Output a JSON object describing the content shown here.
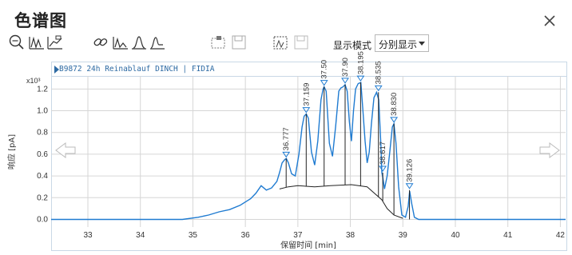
{
  "window": {
    "title": "色谱图"
  },
  "toolbar": {
    "mode_label": "显示模式",
    "mode_value": "分别显示"
  },
  "chart_data": {
    "type": "line",
    "header": "B9872 24h Reinablauf DINCH | FIDIA",
    "xlabel": "保留时间 [min]",
    "ylabel": "响应 [pA]",
    "y_multiplier": "x10³",
    "xlim": [
      32.3,
      42.1
    ],
    "ylim": [
      -0.07,
      1.32
    ],
    "xticks": [
      33,
      34,
      35,
      36,
      37,
      38,
      39,
      40,
      41,
      42
    ],
    "yticks": [
      0.0,
      0.2,
      0.4,
      0.6,
      0.8,
      1.0,
      1.2
    ],
    "grid": true,
    "peaks": [
      {
        "rt": 36.777,
        "label": "36.777",
        "height": 0.56
      },
      {
        "rt": 37.159,
        "label": "37.159",
        "height": 0.97
      },
      {
        "rt": 37.5,
        "label": "37.50",
        "height": 1.22
      },
      {
        "rt": 37.9,
        "label": "37.90",
        "height": 1.24
      },
      {
        "rt": 38.195,
        "label": "38.195",
        "height": 1.26
      },
      {
        "rt": 38.535,
        "label": "38.535",
        "height": 1.17
      },
      {
        "rt": 38.617,
        "label": "38.617",
        "height": 0.43
      },
      {
        "rt": 38.83,
        "label": "38.830",
        "height": 0.88
      },
      {
        "rt": 39.126,
        "label": "39.126",
        "height": 0.27
      }
    ],
    "series": [
      {
        "x": [
          32.3,
          34.8,
          35.1,
          35.3,
          35.5,
          35.7,
          35.9,
          36.0,
          36.1,
          36.2,
          36.3,
          36.4,
          36.5,
          36.6,
          36.65,
          36.7,
          36.75,
          36.78,
          36.82,
          36.88,
          36.95,
          37.02,
          37.08,
          37.12,
          37.16,
          37.2,
          37.26,
          37.32,
          37.38,
          37.44,
          37.48,
          37.5,
          37.54,
          37.6,
          37.66,
          37.72,
          37.78,
          37.82,
          37.86,
          37.9,
          37.94,
          37.98,
          38.02,
          38.06,
          38.1,
          38.15,
          38.2,
          38.24,
          38.28,
          38.32,
          38.36,
          38.4,
          38.45,
          38.5,
          38.54,
          38.58,
          38.6,
          38.62,
          38.65,
          38.7,
          38.75,
          38.8,
          38.83,
          38.87,
          38.92,
          38.98,
          39.05,
          39.1,
          39.13,
          39.17,
          39.22,
          39.3,
          40.0,
          42.1
        ],
        "y": [
          0.0,
          0.0,
          0.02,
          0.04,
          0.07,
          0.09,
          0.13,
          0.16,
          0.19,
          0.24,
          0.31,
          0.27,
          0.29,
          0.35,
          0.43,
          0.52,
          0.55,
          0.56,
          0.52,
          0.42,
          0.4,
          0.6,
          0.85,
          0.95,
          0.97,
          0.93,
          0.62,
          0.5,
          0.72,
          1.1,
          1.2,
          1.22,
          1.18,
          0.7,
          0.58,
          0.86,
          1.18,
          1.21,
          1.22,
          1.24,
          1.18,
          0.9,
          0.72,
          1.0,
          1.2,
          1.25,
          1.26,
          1.0,
          0.72,
          0.52,
          0.62,
          0.88,
          1.12,
          1.17,
          1.1,
          0.7,
          0.43,
          0.38,
          0.28,
          0.4,
          0.62,
          0.85,
          0.88,
          0.7,
          0.3,
          0.04,
          0.02,
          0.12,
          0.26,
          0.14,
          0.02,
          0.0,
          0.0,
          0.0
        ]
      }
    ],
    "baseline": {
      "x": [
        36.65,
        36.82,
        37.0,
        37.32,
        37.62,
        38.02,
        38.32,
        38.6,
        38.7,
        38.83,
        39.0
      ],
      "y": [
        0.28,
        0.3,
        0.31,
        0.3,
        0.31,
        0.32,
        0.3,
        0.18,
        0.1,
        0.04,
        0.01
      ]
    }
  }
}
